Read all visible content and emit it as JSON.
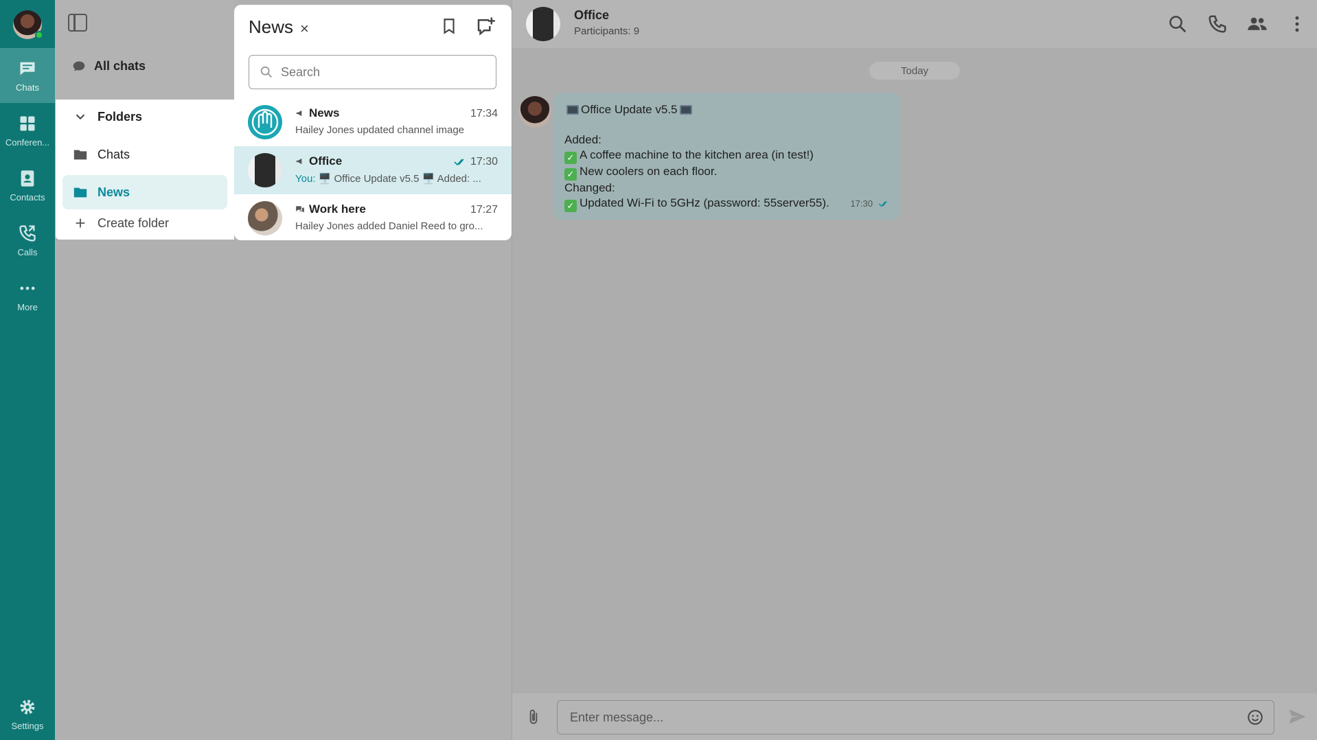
{
  "rail": {
    "items": [
      {
        "label": "Chats",
        "icon": "chat-bubble-icon"
      },
      {
        "label": "Conferen...",
        "icon": "conference-icon"
      },
      {
        "label": "Contacts",
        "icon": "contacts-icon"
      },
      {
        "label": "Calls",
        "icon": "calls-icon"
      },
      {
        "label": "More",
        "icon": "more-dots-icon"
      }
    ],
    "settings_label": "Settings"
  },
  "folders": {
    "all_chats": "All chats",
    "header": "Folders",
    "items": [
      {
        "label": "Chats"
      },
      {
        "label": "News"
      }
    ],
    "create": "Create folder"
  },
  "list": {
    "title": "News",
    "close": "×",
    "search_placeholder": "Search",
    "chats": [
      {
        "name": "News",
        "time": "17:34",
        "preview": "Hailey Jones updated channel image",
        "kind": "channel"
      },
      {
        "name": "Office",
        "time": "17:30",
        "you": "You:",
        "preview": "🖥️ Office Update v5.5 🖥️ Added: ...",
        "kind": "channel",
        "read": true
      },
      {
        "name": "Work here",
        "time": "17:27",
        "preview": "Hailey Jones added Daniel Reed to gro...",
        "kind": "group"
      }
    ]
  },
  "chat": {
    "name": "Office",
    "subtitle": "Participants: 9",
    "date_chip": "Today",
    "message": {
      "title": "Office Update v5.5",
      "added_label": "Added:",
      "added_1": "A coffee machine to the kitchen area (in test!)",
      "added_2": "New coolers on each floor.",
      "changed_label": "Changed:",
      "changed_1": "Updated Wi-Fi to 5GHz (password: 55server55).",
      "time": "17:30"
    },
    "input_placeholder": "Enter message..."
  },
  "colors": {
    "rail": "#0e7774",
    "accent": "#0b8a9a",
    "selected_row": "#d6ecee",
    "bubble": "#9fb3b4"
  }
}
